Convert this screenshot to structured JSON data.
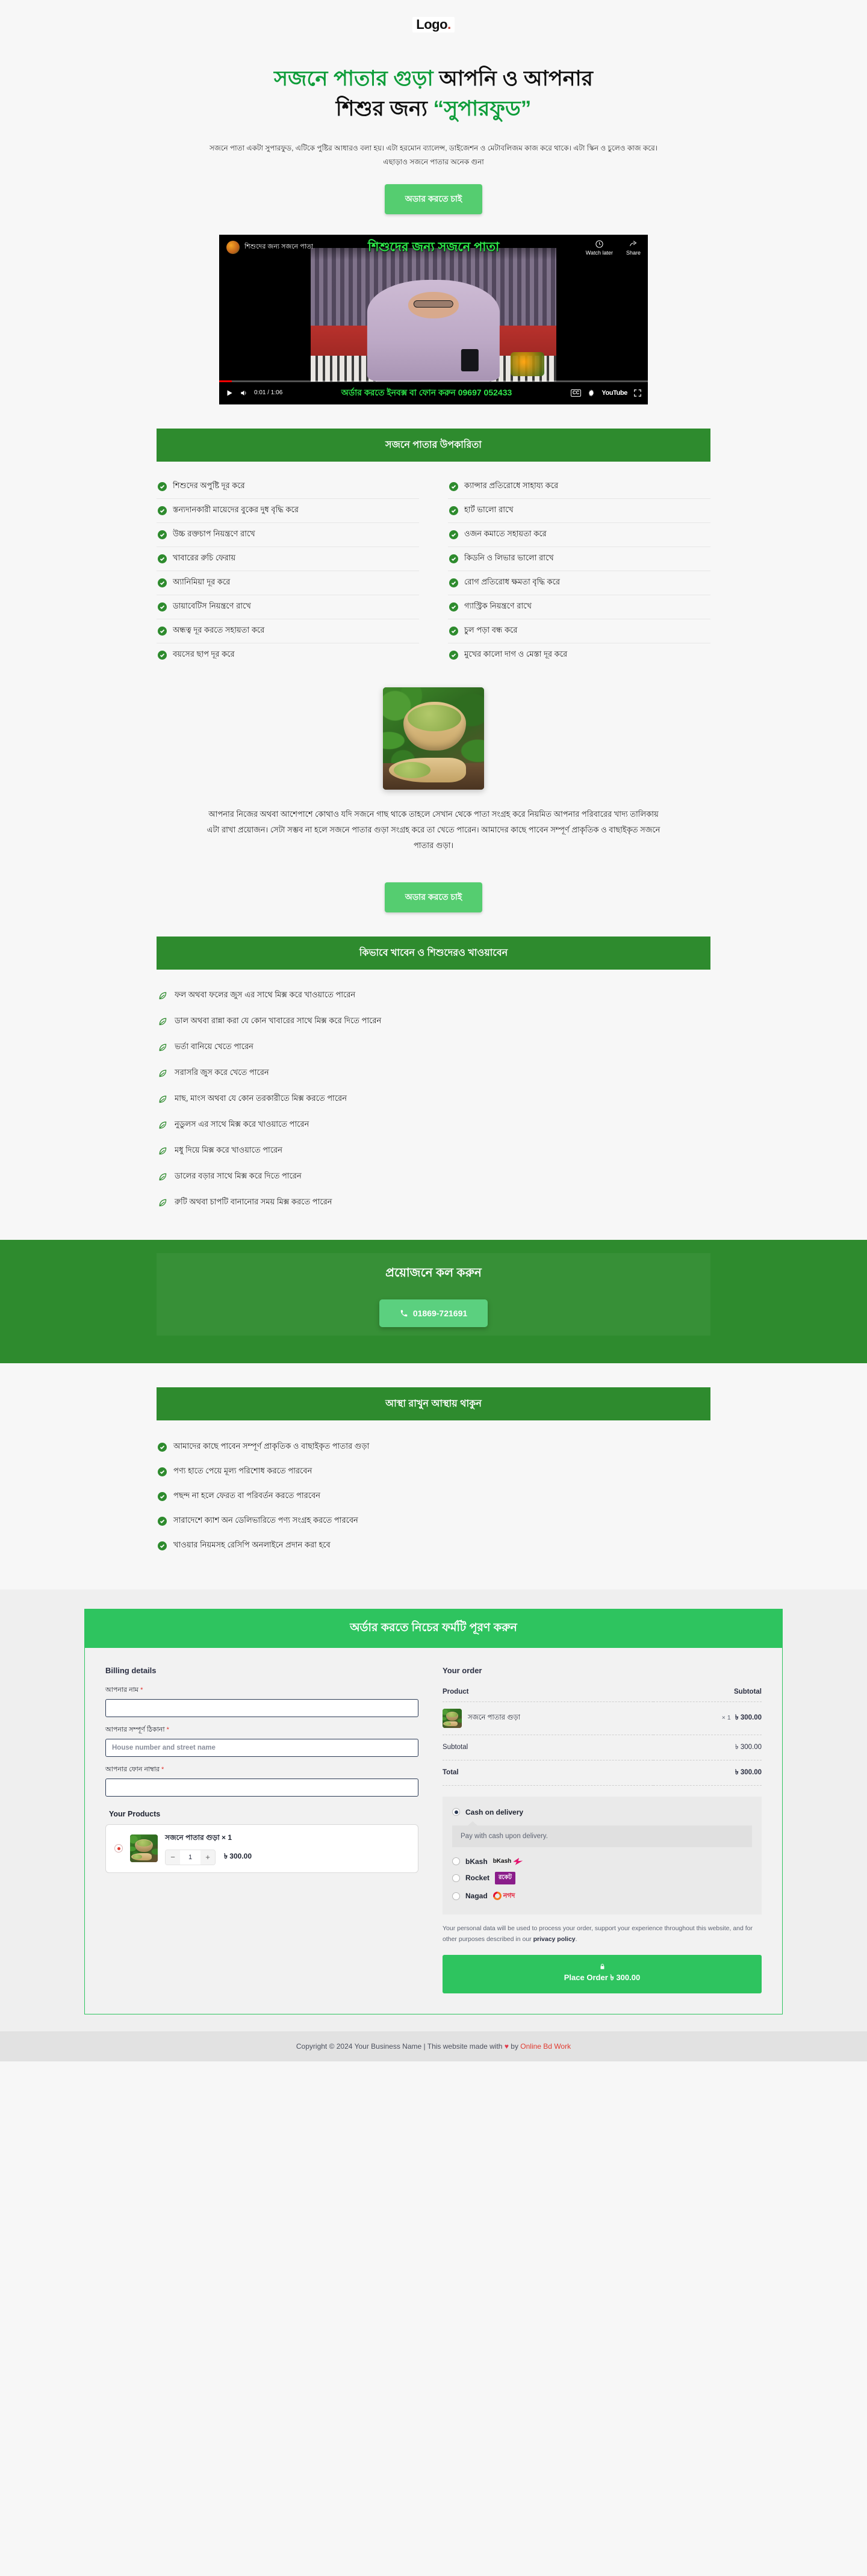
{
  "brand": {
    "logo_text": "Logo",
    "logo_dot": "."
  },
  "hero": {
    "title_line1_highlight": "সজনে পাতার গুড়া",
    "title_line1_rest": " আপনি ও আপনার",
    "title_line2_pre": "শিশুর জন্য ",
    "title_line2_highlight": "“সুপারফুড”",
    "subtitle": "সজনে পাতা একটা সুপারফুড, এটিকে পুষ্টির আধারও বলা হয়। এটা হরমোন ব্যালেন্স, ডাইজেশন ও মেটাবলিজম কাজ করে থাকে। এটা স্কিন ও চুলেও কাজ করে। এছাড়াও সজনে পাতার অনেক গুনা",
    "cta_label": "অডার করতে চাই"
  },
  "video": {
    "channel_title": "শিশুদের জন্য সজনে পাতা",
    "overlay_title": "শিশুদের জন্য সজনে পাতা",
    "watch_later_label": "Watch later",
    "share_label": "Share",
    "time": "0:01 / 1:06",
    "caption": "অর্ডার করতে ইনবক্স বা ফোন করুন 09697 052433",
    "cc_label": "CC",
    "youtube_label": "YouTube"
  },
  "benefits": {
    "heading": "সজনে পাতার উপকারিতা",
    "left": [
      "শিশুদের অপুষ্টি দূর করে",
      "স্তন্যদানকারী মায়েদের বুকের দুধ বৃদ্ধি করে",
      "উচ্চ রক্তচাপ নিয়ন্ত্রণে রাখে",
      "খাবারের রুচি ফেরায়",
      "অ্যানিমিয়া দূর করে",
      "ডায়াবেটিস নিয়ন্ত্রণে রাখে",
      "অন্ধত্ব দূর করতে সহায়তা করে",
      "বয়সের ছাপ দূর করে"
    ],
    "right": [
      "ক্যান্সার প্রতিরোধে সাহায্য করে",
      "হার্ট ভালো রাখে",
      "ওজন কমাতে সহায়তা করে",
      "কিডনি ও লিভার ভালো রাখে",
      "রোগ প্রতিরোধ ক্ষমতা বৃদ্ধি করে",
      "গ্যাস্ট্রিক নিয়ন্ত্রণে রাখে",
      "চুল পড়া বন্ধ করে",
      "মুখের কালো দাগ ও মেস্তা দূর করে"
    ]
  },
  "about": {
    "paragraph": "আপনার নিজের অথবা আশেপাশে কোথাও যদি সজনে গাছ থাকে তাহলে সেখান থেকে পাতা সংগ্রহ করে নিয়মিত আপনার পরিবারের খাদ্য তালিকায় এটা রাখা প্রয়োজন। সেটা সম্ভব না হলে সজনে পাতার গুড়া সংগ্রহ করে তা খেতে পারেন। আমাদের কাছে পাবেন সম্পূর্ণ প্রাকৃতিক ও বাছাইকৃত সজনে পাতার গুড়া।",
    "cta_label": "অডার করতে চাই"
  },
  "howto": {
    "heading": "কিভাবে খাবেন ও শিশুদেরও খাওয়াবেন",
    "items": [
      "ফল অথবা ফলের জুস এর সাথে মিক্স করে খাওয়াতে পারেন",
      "ডাল অথবা রান্না করা যে কোন খাবারের সাথে মিক্স করে দিতে পারেন",
      "ভর্তা বানিয়ে খেতে পারেন",
      "সরাসরি জুস করে খেতে পারেন",
      "মাছ, মাংস অথবা যে কোন তরকারীতে মিক্স করতে পারেন",
      "নুডুলস এর সাথে মিক্স করে খাওয়াতে পারেন",
      "মধু দিয়ে মিক্স করে খাওয়াতে পারেন",
      "ডালের বড়ার সাথে মিক্স করে দিতে পারেন",
      "রুটি অথবা চাপটি বানানোর সময় মিক্স করতে পারেন"
    ]
  },
  "call": {
    "heading": "প্রয়োজনে কল করুন",
    "phone": "01869-721691"
  },
  "trust": {
    "heading": "আস্থা রাখুন আস্থায় থাকুন",
    "items": [
      "আমাদের কাছে পাবেন সম্পূর্ণ প্রাকৃতিক ও বাছাইকৃত পাতার গুড়া",
      "পণ্য হাতে পেয়ে মূল্য পরিশোধ করতে পারবেন",
      "পছন্দ না হলে ফেরত বা পরিবর্তন করতে পারবেন",
      "সারাদেশে ক্যাশ অন ডেলিভারিতে পণ্য সংগ্রহ করতে পারবেন",
      "খাওয়ার নিয়মসহ রেসিপি অনলাইনে প্রদান করা হবে"
    ]
  },
  "checkout": {
    "heading": "অর্ডার করতে নিচের ফর্মটি পূরণ করুন",
    "billing_title": "Billing details",
    "fields": [
      {
        "label": "আপনার নাম",
        "required": "*",
        "value": "",
        "placeholder": ""
      },
      {
        "label": "আপনার সম্পূর্ণ ঠিকানা",
        "required": "*",
        "value": "",
        "placeholder": "House number and street name"
      },
      {
        "label": "আপনার ফোন নাম্বার",
        "required": "*",
        "value": "",
        "placeholder": ""
      }
    ],
    "your_products_title": "Your Products",
    "cart_item": {
      "name": "সজনে পাতার গুড়া × 1",
      "qty": "1",
      "minus": "−",
      "plus": "+",
      "price": "৳ 300.00"
    },
    "order_title": "Your order",
    "table": {
      "col_product": "Product",
      "col_subtotal": "Subtotal",
      "row_product_name": "সজনে পাতার গুড়া",
      "row_qty": "× 1",
      "row_price": "৳ 300.00",
      "subtotal_label": "Subtotal",
      "subtotal_value": "৳ 300.00",
      "total_label": "Total",
      "total_value": "৳ 300.00"
    },
    "payments": [
      {
        "label": "Cash on delivery",
        "selected": true,
        "logo": ""
      },
      {
        "label": "bKash",
        "selected": false,
        "logo": "bKash"
      },
      {
        "label": "Rocket",
        "selected": false,
        "logo": "রকেট"
      },
      {
        "label": "Nagad",
        "selected": false,
        "logo": "নগদ"
      }
    ],
    "cod_description": "Pay with cash upon delivery.",
    "privacy_text": "Your personal data will be used to process your order, support your experience throughout this website, and for other purposes described in our ",
    "privacy_link": "privacy policy",
    "privacy_end": ".",
    "place_order_label": "Place Order  ৳ 300.00"
  },
  "footer": {
    "text": "Copyright © 2024 Your Business Name | This website made with ",
    "heart": "♥",
    "by": " by ",
    "credit": "Online Bd Work"
  },
  "colors": {
    "green_dark": "#2e8b2e",
    "green_bright": "#2ec45f",
    "green_cta": "#55cd70",
    "red": "#e03a2f"
  }
}
